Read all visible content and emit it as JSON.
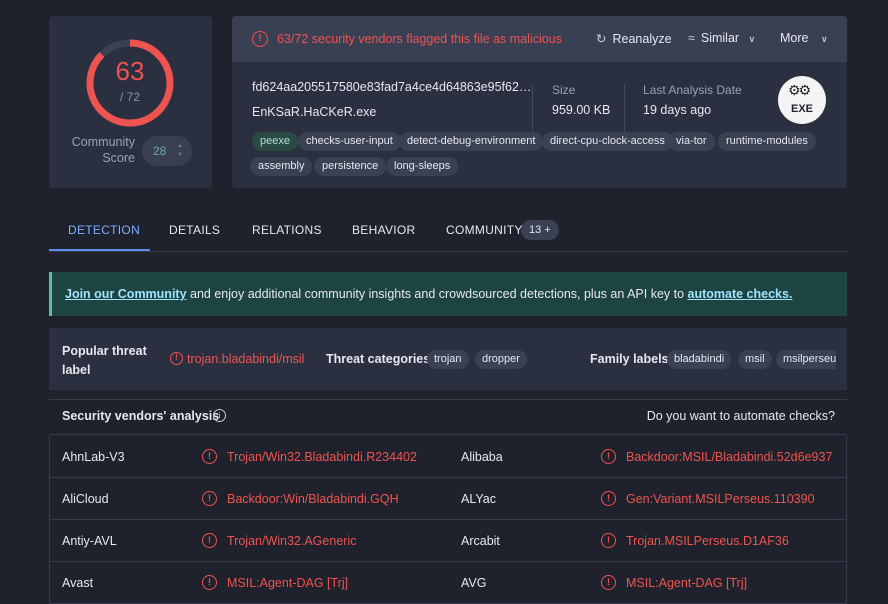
{
  "score": {
    "detected": "63",
    "total": "/ 72",
    "detected_fraction": 0.875,
    "community_label_line1": "Community",
    "community_label_line2": "Score",
    "community_score": "28"
  },
  "alert": {
    "text": "63/72 security vendors flagged this file as malicious",
    "color": "#ef5350"
  },
  "actions": {
    "reanalyze": "Reanalyze",
    "similar": "Similar",
    "more": "More"
  },
  "file": {
    "hash": "fd624aa205517580e83fad7a4ce4d64863e95f62…",
    "name": "EnKSaR.HaCKeR.exe",
    "size_label": "Size",
    "size": "959.00 KB",
    "date_label": "Last Analysis Date",
    "date": "19 days ago",
    "type_icon": "EXE"
  },
  "tags": [
    "peexe",
    "checks-user-input",
    "detect-debug-environment",
    "direct-cpu-clock-access",
    "via-tor",
    "runtime-modules",
    "assembly",
    "persistence",
    "long-sleeps"
  ],
  "tabs": [
    "DETECTION",
    "DETAILS",
    "RELATIONS",
    "BEHAVIOR",
    "COMMUNITY"
  ],
  "community_badge": "13 +",
  "banner": {
    "link1": "Join our Community",
    "middle": " and enjoy additional community insights and crowdsourced detections, plus an API key to ",
    "link2": "automate checks."
  },
  "threat": {
    "popular_label_line1": "Popular threat",
    "popular_label_line2": "label",
    "popular_value": "trojan.bladabindi/msil",
    "categories_label": "Threat categories",
    "categories": [
      "trojan",
      "dropper"
    ],
    "family_label": "Family labels",
    "families": [
      "bladabindi",
      "msil",
      "msilperseus"
    ]
  },
  "analysis": {
    "title": "Security vendors' analysis",
    "automate_prompt": "Do you want to automate checks?"
  },
  "vendors": [
    {
      "left_name": "AhnLab-V3",
      "left_result": "Trojan/Win32.Bladabindi.R234402",
      "right_name": "Alibaba",
      "right_result": "Backdoor:MSIL/Bladabindi.52d6e937"
    },
    {
      "left_name": "AliCloud",
      "left_result": "Backdoor:Win/Bladabindi.GQH",
      "right_name": "ALYac",
      "right_result": "Gen:Variant.MSILPerseus.110390"
    },
    {
      "left_name": "Antiy-AVL",
      "left_result": "Trojan/Win32.AGeneric",
      "right_name": "Arcabit",
      "right_result": "Trojan.MSILPerseus.D1AF36"
    },
    {
      "left_name": "Avast",
      "left_result": "MSIL:Agent-DAG [Trj]",
      "right_name": "AVG",
      "right_result": "MSIL:Agent-DAG [Trj]"
    }
  ]
}
